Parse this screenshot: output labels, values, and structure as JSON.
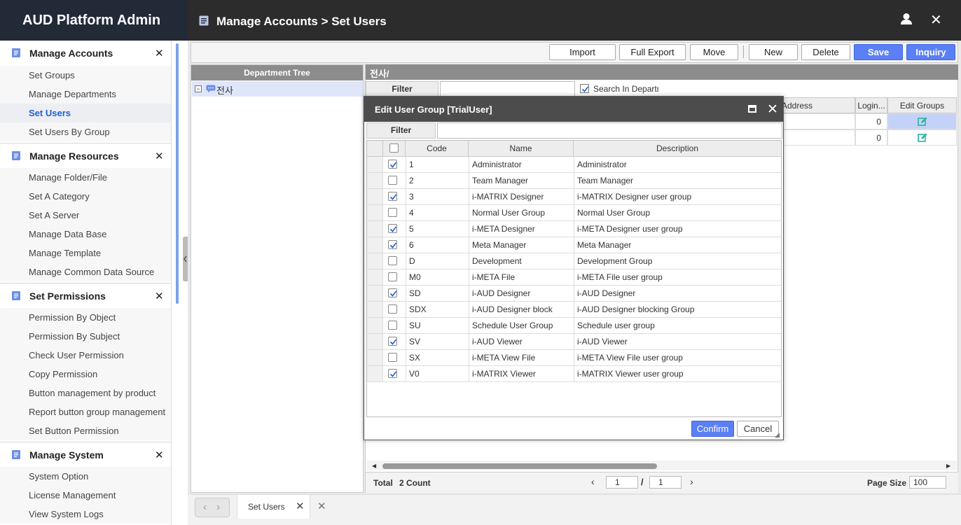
{
  "app": {
    "title": "AUD Platform Admin",
    "breadcrumb": "Manage Accounts > Set Users"
  },
  "sidebar": {
    "groups": [
      {
        "label": "Manage Accounts",
        "items": [
          "Set Groups",
          "Manage Departments",
          "Set Users",
          "Set Users By Group"
        ]
      },
      {
        "label": "Manage Resources",
        "items": [
          "Manage Folder/File",
          "Set A Category",
          "Set A Server",
          "Manage Data Base",
          "Manage Template",
          "Manage Common Data Source"
        ]
      },
      {
        "label": "Set Permissions",
        "items": [
          "Permission By Object",
          "Permission By Subject",
          "Check User Permission",
          "Copy Permission",
          "Button management by product",
          "Report button group management",
          "Set Button Permission"
        ]
      },
      {
        "label": "Manage System",
        "items": [
          "System Option",
          "License Management",
          "View System Logs"
        ]
      }
    ],
    "active": "Set Users"
  },
  "toolbar": {
    "import": "Import",
    "full_export": "Full Export",
    "move": "Move",
    "new": "New",
    "delete": "Delete",
    "save": "Save",
    "inquiry": "Inquiry"
  },
  "tree": {
    "header": "Department Tree",
    "root": "전사"
  },
  "right": {
    "path": "전사/",
    "filter_label": "Filter",
    "search_in_dept": "Search In Department",
    "cols": {
      "address": "Address",
      "login": "Login...",
      "edit_groups": "Edit Groups"
    },
    "rows": [
      {
        "login": "0"
      },
      {
        "login": "0"
      }
    ]
  },
  "footer": {
    "total_label": "Total",
    "count": "2 Count",
    "page": "1",
    "slash": "/",
    "pages": "1",
    "page_size_label": "Page Size",
    "page_size": "100"
  },
  "tabs": {
    "active": "Set Users"
  },
  "modal": {
    "title": "Edit User Group [TrialUser]",
    "filter_label": "Filter",
    "cols": {
      "code": "Code",
      "name": "Name",
      "description": "Description"
    },
    "rows": [
      {
        "checked": true,
        "code": "1",
        "name": "Administrator",
        "description": "Administrator"
      },
      {
        "checked": false,
        "code": "2",
        "name": "Team Manager",
        "description": "Team Manager"
      },
      {
        "checked": true,
        "code": "3",
        "name": "i-MATRIX Designer",
        "description": "i-MATRIX Designer user group"
      },
      {
        "checked": false,
        "code": "4",
        "name": "Normal User Group",
        "description": "Normal User Group"
      },
      {
        "checked": true,
        "code": "5",
        "name": "i-META Designer",
        "description": "i-META Designer user group"
      },
      {
        "checked": true,
        "code": "6",
        "name": "Meta Manager",
        "description": "Meta Manager"
      },
      {
        "checked": false,
        "code": "D",
        "name": "Development",
        "description": "Development Group"
      },
      {
        "checked": false,
        "code": "M0",
        "name": "i-META File",
        "description": "i-META File user group"
      },
      {
        "checked": true,
        "code": "SD",
        "name": "i-AUD Designer",
        "description": "i-AUD Designer"
      },
      {
        "checked": false,
        "code": "SDX",
        "name": "i-AUD Designer block",
        "description": "i-AUD Designer blocking Group"
      },
      {
        "checked": false,
        "code": "SU",
        "name": "Schedule User Group",
        "description": "Schedule user group"
      },
      {
        "checked": true,
        "code": "SV",
        "name": "i-AUD Viewer",
        "description": "i-AUD Viewer"
      },
      {
        "checked": false,
        "code": "SX",
        "name": "i-META View File",
        "description": "i-META View File user group"
      },
      {
        "checked": true,
        "code": "V0",
        "name": "i-MATRIX Viewer",
        "description": "i-MATRIX Viewer user group"
      }
    ],
    "confirm": "Confirm",
    "cancel": "Cancel"
  },
  "colors": {
    "brand_bg": "#222a38",
    "accent": "#5b7ff5",
    "check": "#1f5fd4",
    "edit_icon": "#2bb39a"
  }
}
